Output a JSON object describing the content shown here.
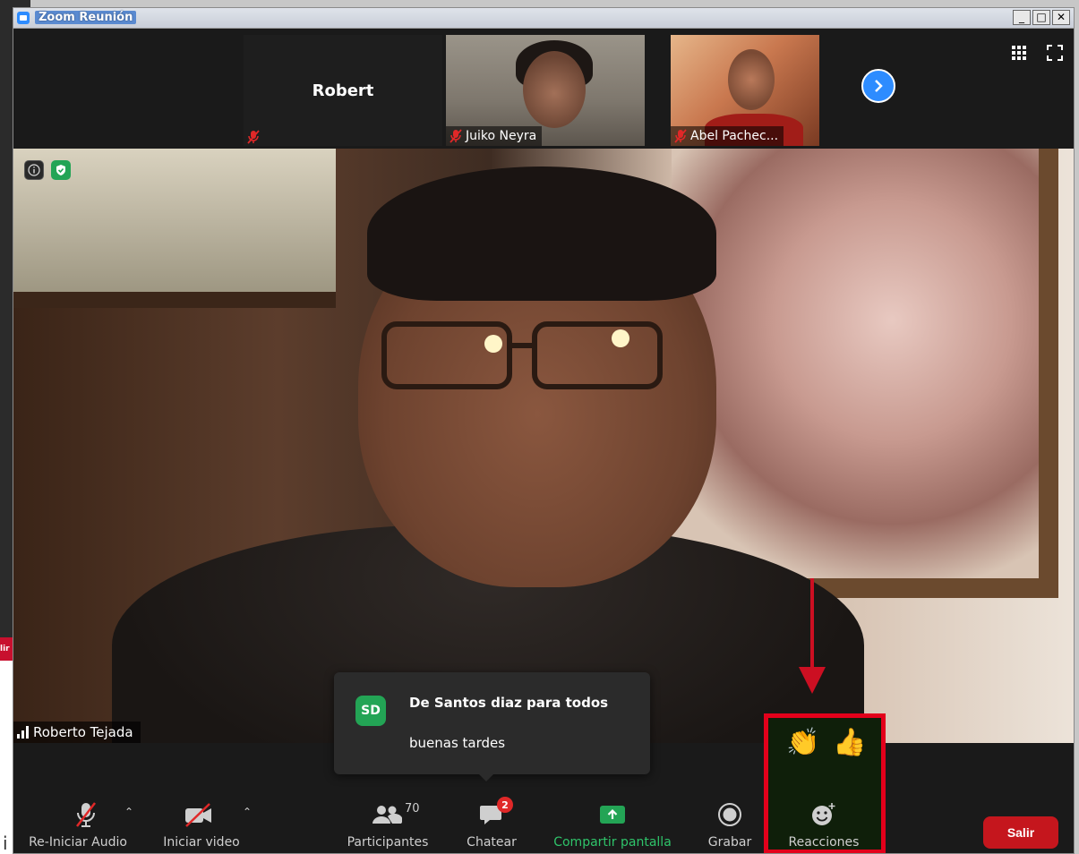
{
  "window": {
    "title": "Zoom Reunión"
  },
  "outside": {
    "left_label": "lir",
    "bottom_glyph": "i"
  },
  "gallery": {
    "participants": [
      {
        "name": "Robert",
        "muted": true
      },
      {
        "name": "Juiko Neyra",
        "muted": true
      },
      {
        "name": "Abel Pachec...",
        "muted": true
      }
    ]
  },
  "main_video": {
    "speaker": "Roberto Tejada"
  },
  "chat_notification": {
    "avatar_initials": "SD",
    "sender": "De Santos diaz para todos",
    "message": "buenas tardes"
  },
  "toolbar": {
    "audio_label": "Re-Iniciar Audio",
    "video_label": "Iniciar video",
    "participants_label": "Participantes",
    "participants_count": "70",
    "chat_label": "Chatear",
    "chat_unread": "2",
    "share_label": "Compartir pantalla",
    "record_label": "Grabar",
    "reactions_label": "Reacciones",
    "leave_label": "Salir"
  },
  "reactions": {
    "items": [
      "👏",
      "👍"
    ]
  },
  "colors": {
    "accent": "#2d8cff",
    "leave": "#c5161d",
    "highlight": "#e3001b",
    "share": "#23a455"
  }
}
